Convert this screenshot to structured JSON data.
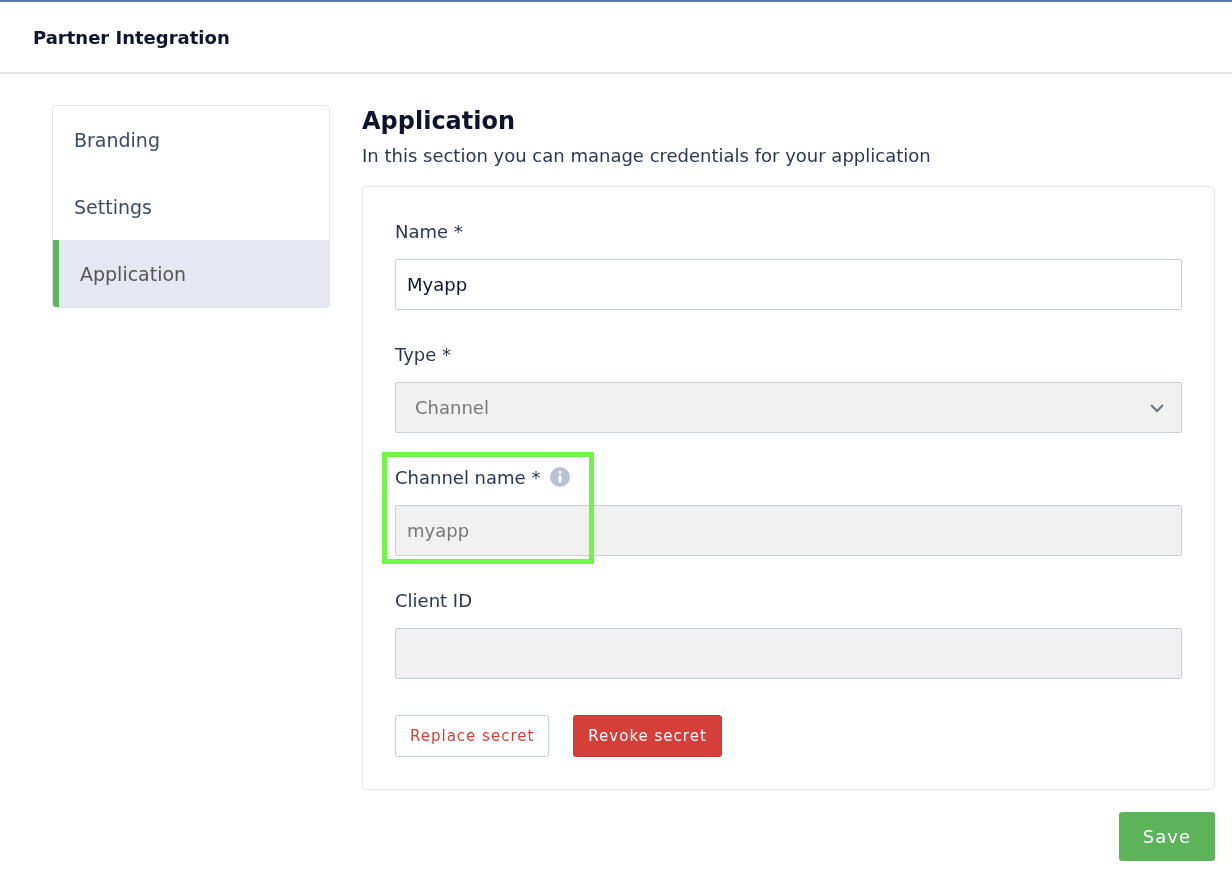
{
  "header": {
    "title": "Partner Integration"
  },
  "sidebar": {
    "items": [
      {
        "label": "Branding",
        "selected": false
      },
      {
        "label": "Settings",
        "selected": false
      },
      {
        "label": "Application",
        "selected": true
      }
    ]
  },
  "section": {
    "title": "Application",
    "subtitle": "In this section you can manage credentials for your application"
  },
  "fields": [
    {
      "kind": "text",
      "label": "Name *",
      "value": "Myapp",
      "disabled": false,
      "info": false,
      "highlighted": false
    },
    {
      "kind": "select",
      "label": "Type *",
      "value": "Channel",
      "disabled": true,
      "info": false,
      "highlighted": false
    },
    {
      "kind": "text",
      "label": "Channel name *",
      "value": "myapp",
      "disabled": true,
      "info": true,
      "highlighted": true
    },
    {
      "kind": "text",
      "label": "Client ID",
      "disabled": true,
      "info": false,
      "highlighted": false
    }
  ],
  "buttons": [
    {
      "kind": "outline",
      "label": "Replace secret"
    },
    {
      "kind": "danger",
      "label": "Revoke secret"
    }
  ],
  "save_button": "Save"
}
